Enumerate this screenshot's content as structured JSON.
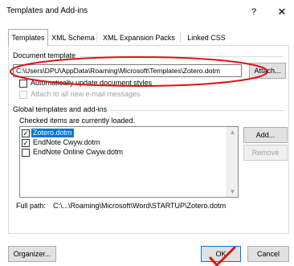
{
  "window": {
    "title": "Templates and Add-ins",
    "help_glyph": "?",
    "close_glyph": "✕"
  },
  "tabs": [
    {
      "label": "Templates",
      "active": true
    },
    {
      "label": "XML Schema",
      "active": false
    },
    {
      "label": "XML Expansion Packs",
      "active": false
    },
    {
      "label": "Linked CSS",
      "active": false
    }
  ],
  "document_template": {
    "group_label": "Document template",
    "path": "C:\\Users\\DPU\\AppData\\Roaming\\Microsoft\\Templates\\Zotero.dotm",
    "attach_label": "Attach...",
    "auto_update_label": "Automatically update document styles",
    "attach_email_label": "Attach to all new e-mail messages"
  },
  "global": {
    "group_label": "Global templates and add-ins",
    "loaded_note": "Checked items are currently loaded.",
    "items": [
      {
        "label": "Zotero.dotm",
        "checked": true,
        "selected": true
      },
      {
        "label": "EndNote Cwyw.dotm",
        "checked": true,
        "selected": false
      },
      {
        "label": "EndNote Online Cwyw.dotm",
        "checked": false,
        "selected": false
      }
    ],
    "add_label": "Add...",
    "remove_label": "Remove"
  },
  "full_path": {
    "label": "Full path:",
    "value": "C:\\...\\Roaming\\Microsoft\\Word\\STARTUP\\Zotero.dotm"
  },
  "footer": {
    "organizer_label": "Organizer...",
    "ok_label": "OK",
    "cancel_label": "Cancel"
  },
  "annotation_color": "#d9141c"
}
